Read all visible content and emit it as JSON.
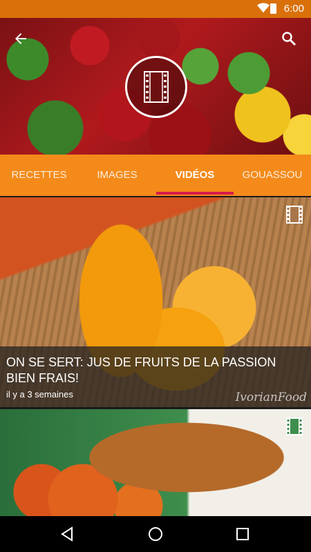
{
  "status_bar": {
    "time": "6:00",
    "icons": [
      "wifi-icon",
      "battery-icon"
    ]
  },
  "header": {
    "back_icon": "arrow-back-icon",
    "search_icon": "search-icon",
    "badge_icon": "film-icon"
  },
  "tabs": [
    {
      "label": "RECETTES",
      "active": false
    },
    {
      "label": "IMAGES",
      "active": false
    },
    {
      "label": "VIDÉOS",
      "active": true
    },
    {
      "label": "GOUASSOU",
      "active": false
    }
  ],
  "colors": {
    "accent": "#f48a1a",
    "status_bar": "#d9700a",
    "indicator": "#d8194d"
  },
  "videos": [
    {
      "title": "ON SE SERT: JUS DE FRUITS DE LA PASSION BIEN FRAIS!",
      "time_ago": "il y a 3 semaines",
      "watermark": "IvorianFood",
      "icon": "film-icon"
    },
    {
      "title": "",
      "time_ago": "",
      "icon": "film-icon"
    }
  ],
  "nav_bar": [
    "back-triangle-icon",
    "home-circle-icon",
    "recents-square-icon"
  ]
}
